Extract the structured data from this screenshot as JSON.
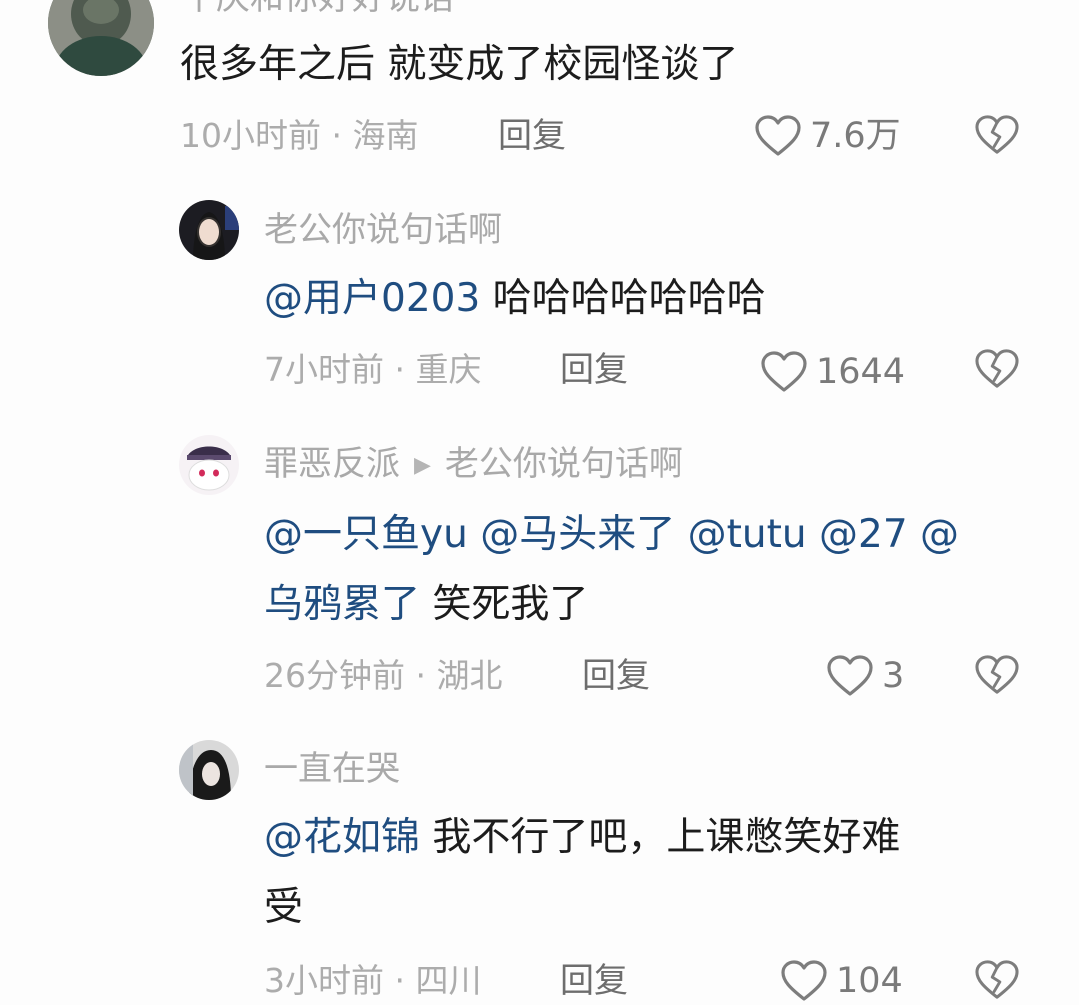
{
  "comments": [
    {
      "username": "十庆和你好好说话",
      "text_plain": "很多年之后 就变成了校园怪谈了",
      "time": "10小时前",
      "location": "海南",
      "reply_label": "回复",
      "likes": "7.6万"
    },
    {
      "username": "老公你说句话啊",
      "mention": "@用户0203",
      "text_plain": " 哈哈哈哈哈哈哈",
      "time": "7小时前",
      "location": "重庆",
      "reply_label": "回复",
      "likes": "1644"
    },
    {
      "username": "罪恶反派",
      "reply_to": "老公你说句话啊",
      "mention_line1": "@一只鱼yu @马头来了 @tutu @27 @",
      "mention_line2": "乌鸦累了",
      "text_plain": " 笑死我了",
      "time": "26分钟前",
      "location": "湖北",
      "reply_label": "回复",
      "likes": "3"
    },
    {
      "username": "一直在哭",
      "mention": "@花如锦",
      "text_plain": " 我不行了吧，上课憋笑好难",
      "text_line2": "受",
      "time": "3小时前",
      "location": "四川",
      "reply_label": "回复",
      "likes": "104"
    }
  ],
  "separator": "·",
  "icons": {
    "like": "heart-outline-icon",
    "dislike": "broken-heart-icon",
    "reply_to": "triangle-right-icon"
  },
  "colors": {
    "mention": "#1f4d80",
    "meta": "#acacac",
    "username": "#a9a9a9",
    "text": "#1c1c1c"
  }
}
